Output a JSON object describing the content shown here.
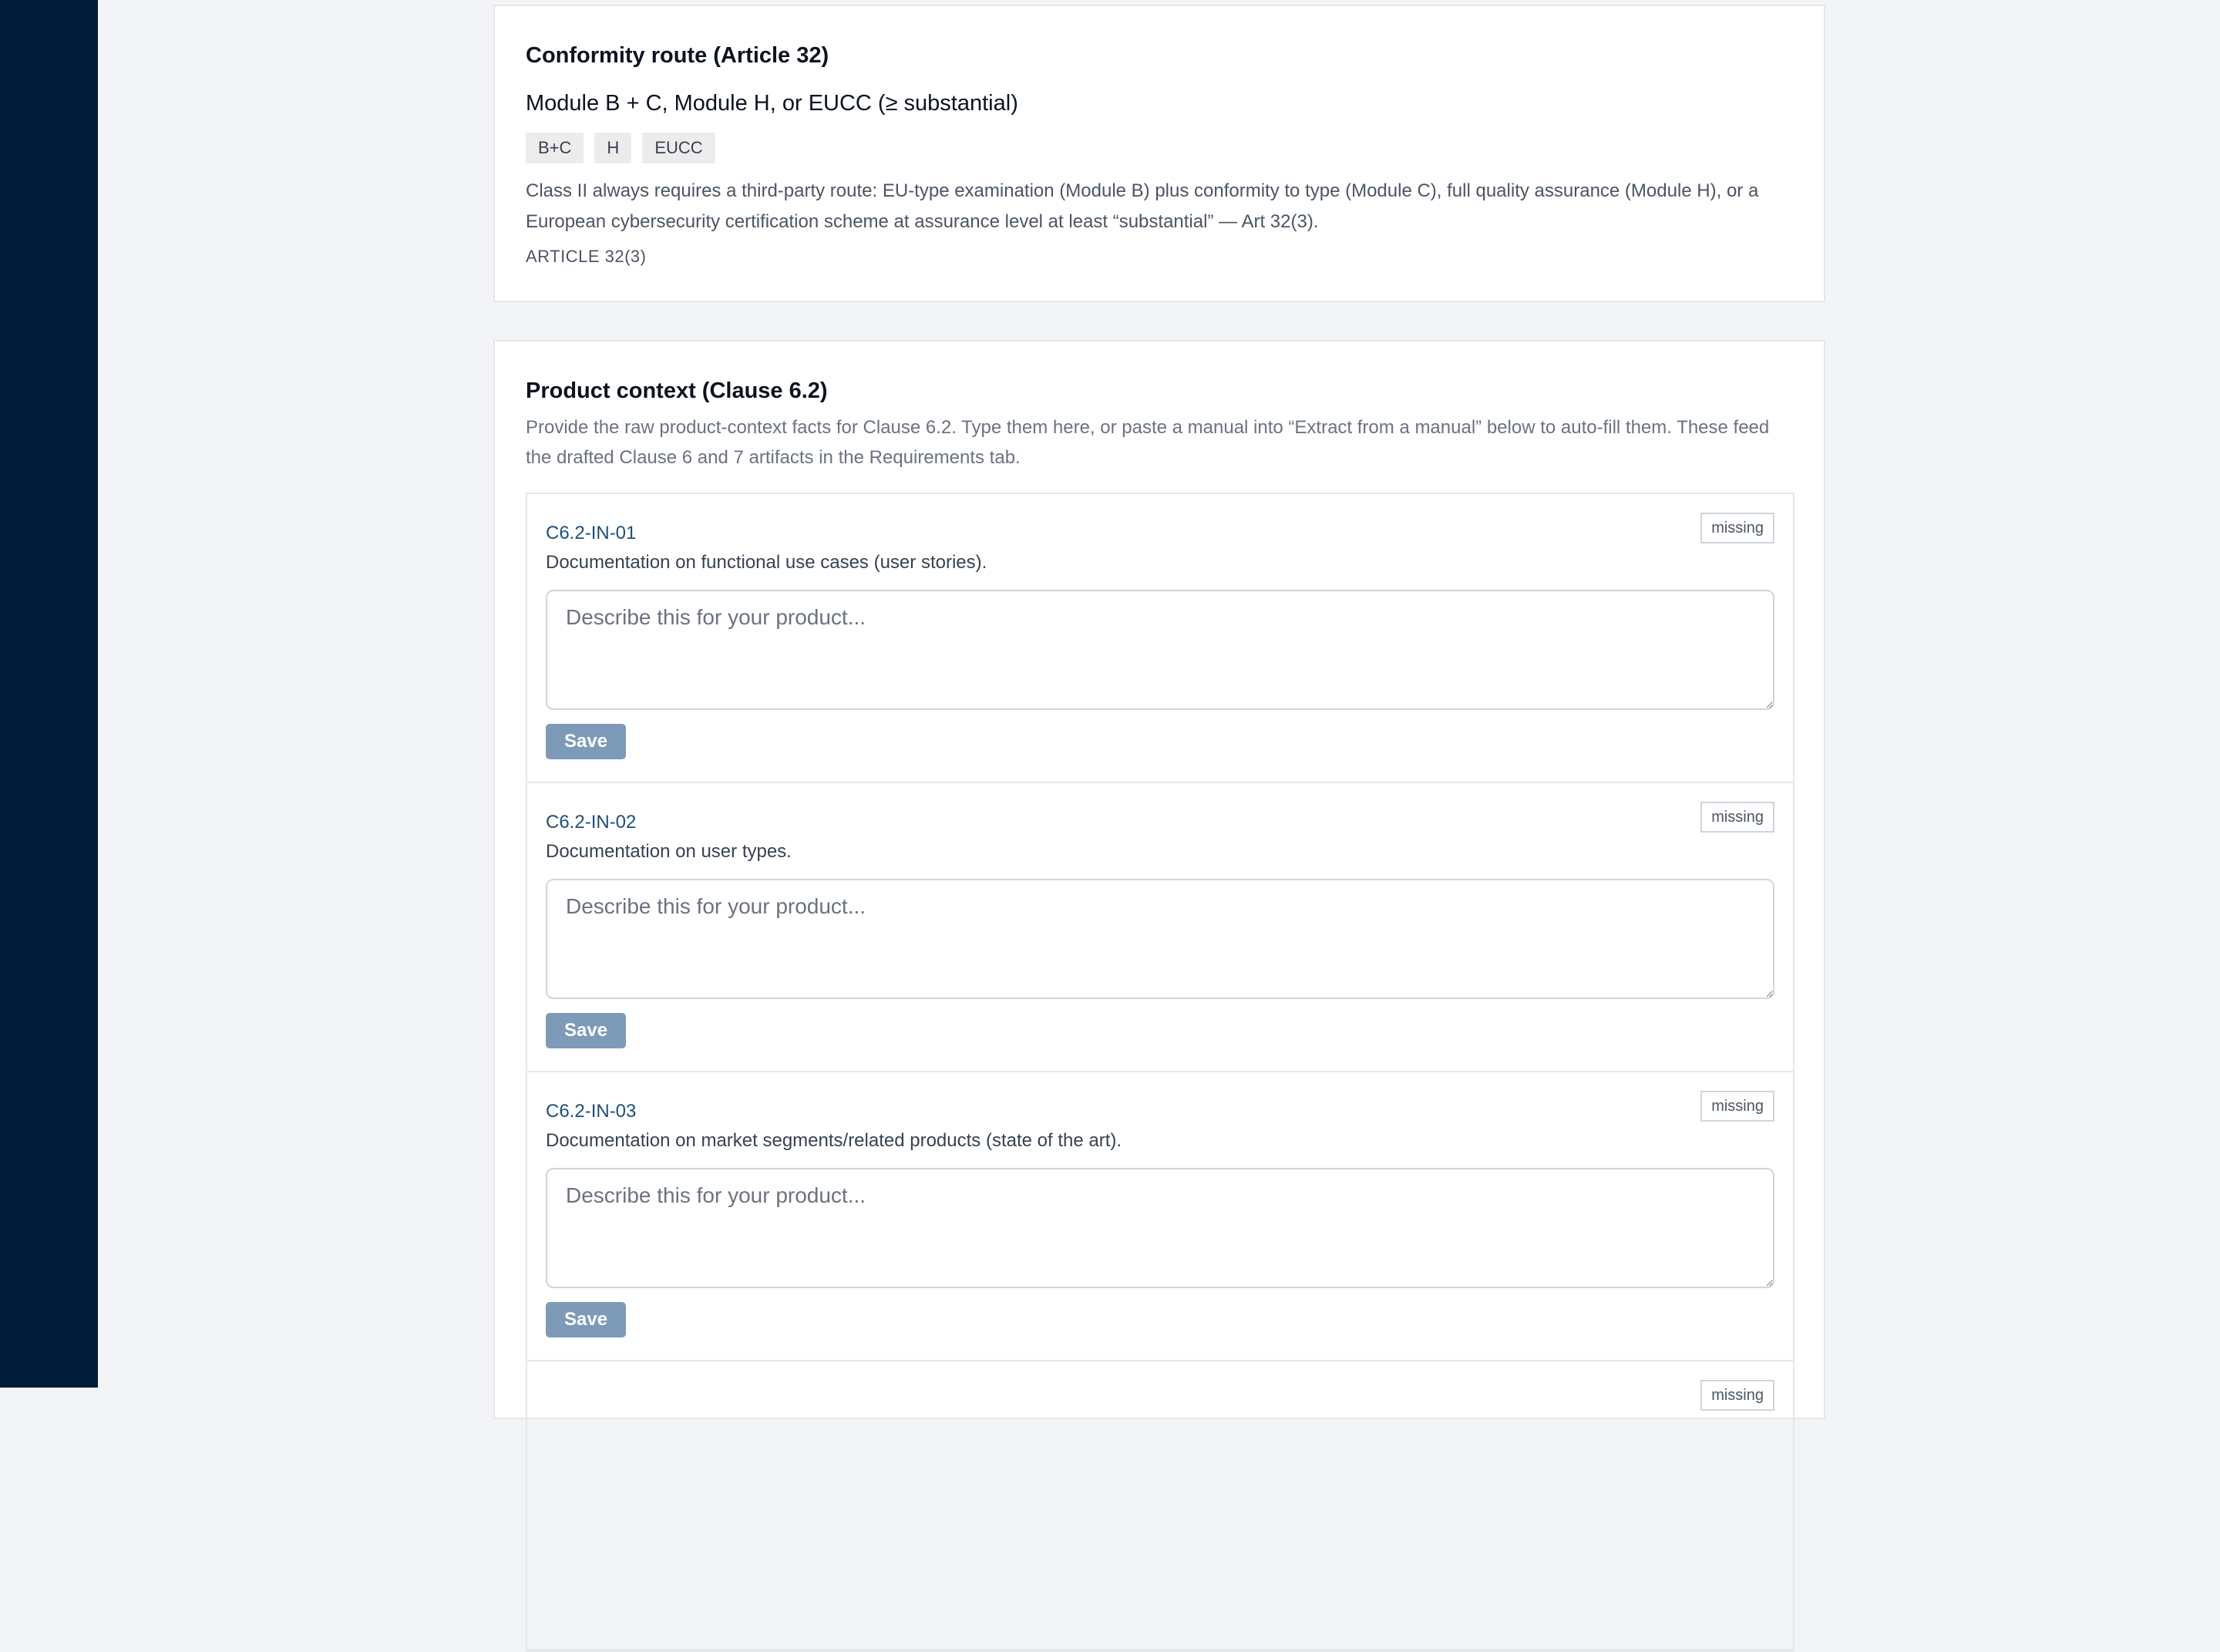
{
  "conformity": {
    "title": "Conformity route (Article 32)",
    "route": "Module B + C, Module H, or EUCC (≥ substantial)",
    "chips": [
      "B+C",
      "H",
      "EUCC"
    ],
    "description": "Class II always requires a third-party route: EU-type examination (Module B) plus conformity to type (Module C), full quality assurance (Module H), or a European cybersecurity certification scheme at assurance level at least “substantial” — Art 32(3).",
    "article": "ARTICLE 32(3)"
  },
  "context": {
    "title": "Product context (Clause 6.2)",
    "intro": "Provide the raw product-context facts for Clause 6.2. Type them here, or paste a manual into “Extract from a manual” below to auto-fill them. These feed the drafted Clause 6 and 7 artifacts in the Requirements tab.",
    "placeholder": "Describe this for your product...",
    "save_label": "Save",
    "items": [
      {
        "code": "C6.2-IN-01",
        "label": "Documentation on functional use cases (user stories).",
        "status": "missing",
        "value": ""
      },
      {
        "code": "C6.2-IN-02",
        "label": "Documentation on user types.",
        "status": "missing",
        "value": ""
      },
      {
        "code": "C6.2-IN-03",
        "label": "Documentation on market segments/related products (state of the art).",
        "status": "missing",
        "value": ""
      },
      {
        "code": "",
        "label": "",
        "status": "missing",
        "value": ""
      }
    ]
  }
}
